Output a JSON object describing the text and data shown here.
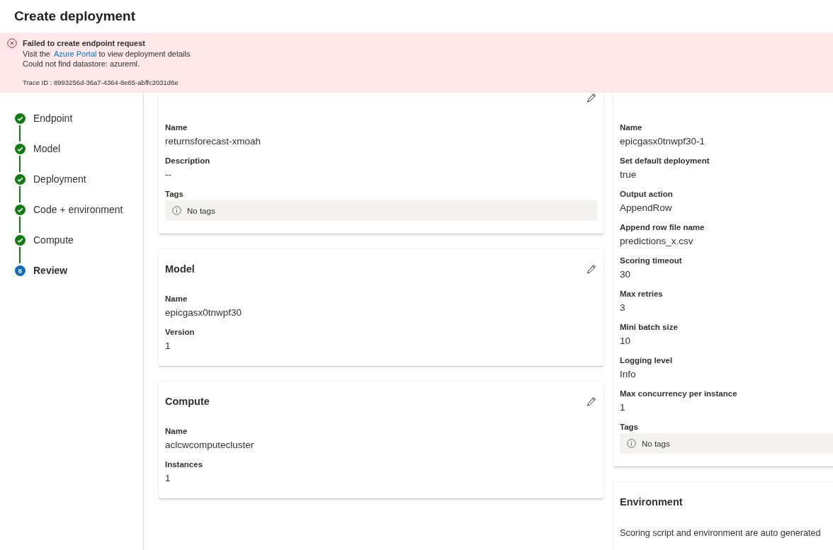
{
  "header": {
    "title": "Create deployment"
  },
  "error_banner": {
    "title": "Failed to create endpoint request",
    "link_prefix": "Visit the",
    "link": "Azure Portal",
    "link_suffix": "to view deployment details",
    "detail": "Could not find datastore: azureml.",
    "trace": "Trace ID : 8993256d-36a7-4364-8e65-abffc2031d6e"
  },
  "steps": [
    {
      "label": "Endpoint",
      "kind": "done",
      "selected": false
    },
    {
      "label": "Model",
      "kind": "done",
      "selected": false
    },
    {
      "label": "Deployment",
      "kind": "done",
      "selected": false
    },
    {
      "label": "Code + environment",
      "kind": "done",
      "selected": false
    },
    {
      "label": "Compute",
      "kind": "done",
      "selected": false
    },
    {
      "label": "Review",
      "kind": "current",
      "number": "6",
      "selected": true
    }
  ],
  "left_cards": [
    {
      "editable": true,
      "fields": [
        {
          "kind": "text",
          "label": "Name",
          "value": "returnsforecast-xmoah"
        },
        {
          "kind": "text",
          "label": "Description",
          "value": "--"
        },
        {
          "kind": "tags",
          "label": "Tags",
          "value": "No tags"
        }
      ]
    },
    {
      "title": "Model",
      "editable": true,
      "fields": [
        {
          "kind": "text",
          "label": "Name",
          "value": "epicgasx0tnwpf30"
        },
        {
          "kind": "text",
          "label": "Version",
          "value": "1"
        }
      ]
    },
    {
      "title": "Compute",
      "editable": true,
      "fields": [
        {
          "kind": "text",
          "label": "Name",
          "value": "aclcwcomputecluster"
        },
        {
          "kind": "text",
          "label": "Instances",
          "value": "1"
        }
      ]
    }
  ],
  "right_cards": [
    {
      "editable": false,
      "fields": [
        {
          "kind": "text",
          "label": "Name",
          "value": "epicgasx0tnwpf30-1"
        },
        {
          "kind": "text",
          "label": "Set default deployment",
          "value": "true"
        },
        {
          "kind": "text",
          "label": "Output action",
          "value": "AppendRow"
        },
        {
          "kind": "text",
          "label": "Append row file name",
          "value": "predictions_x.csv"
        },
        {
          "kind": "text",
          "label": "Scoring timeout",
          "value": "30"
        },
        {
          "kind": "text",
          "label": "Max retries",
          "value": "3"
        },
        {
          "kind": "text",
          "label": "Mini batch size",
          "value": "10"
        },
        {
          "kind": "text",
          "label": "Logging level",
          "value": "Info"
        },
        {
          "kind": "text",
          "label": "Max concurrency per instance",
          "value": "1"
        },
        {
          "kind": "tags",
          "label": "Tags",
          "value": "No tags"
        }
      ]
    },
    {
      "title": "Environment",
      "editable": false,
      "fields": [
        {
          "kind": "note",
          "value": "Scoring script and environment are auto generated"
        }
      ]
    }
  ]
}
